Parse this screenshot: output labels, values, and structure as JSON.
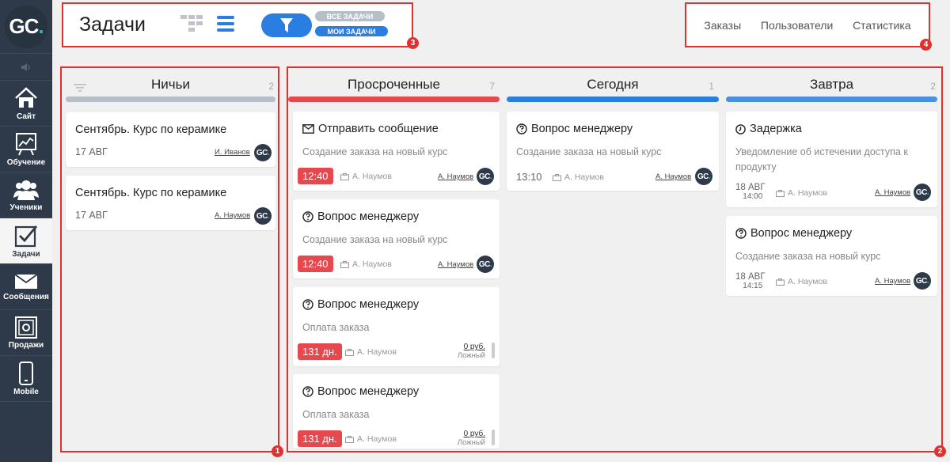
{
  "logo": {
    "text_main": "GC",
    "text_dot": "."
  },
  "sidebar": {
    "items": [
      {
        "label": "Сайт",
        "icon": "house-icon"
      },
      {
        "label": "Обучение",
        "icon": "chart-board-icon"
      },
      {
        "label": "Ученики",
        "icon": "users-icon"
      },
      {
        "label": "Задачи",
        "icon": "checkbox-icon",
        "active": true
      },
      {
        "label": "Сообщения",
        "icon": "envelope-icon"
      },
      {
        "label": "Продажи",
        "icon": "safe-icon"
      },
      {
        "label": "Mobile",
        "icon": "phone-icon"
      }
    ]
  },
  "header": {
    "title": "Задачи",
    "pill_all": "ВСЕ ЗАДАЧИ",
    "pill_mine": "МОИ ЗАДАЧИ",
    "links": [
      "Заказы",
      "Пользователи",
      "Статистика"
    ]
  },
  "annotations": [
    "1",
    "2",
    "3",
    "4"
  ],
  "colors": {
    "accent": "#2a7de1",
    "danger": "#e5484d",
    "gray_bar": "#b8bec8",
    "frame": "#e03131"
  },
  "columns": {
    "nobody": {
      "title": "Ничьи",
      "count": "2",
      "cards": [
        {
          "title": "Сентябрь. Курс по керамике",
          "date": "17 АВГ",
          "user": "И. Иванов"
        },
        {
          "title": "Сентябрь. Курс по керамике",
          "date": "17 АВГ",
          "user": "А. Наумов"
        }
      ]
    },
    "overdue": {
      "title": "Просроченные",
      "count": "7",
      "cards": [
        {
          "title": "Отправить сообщение",
          "sub": "Создание заказа на новый курс",
          "time": "12:40",
          "assignee": "А. Наумов",
          "user": "А. Наумов"
        },
        {
          "title": "Вопрос менеджеру",
          "sub": "Создание заказа на новый курс",
          "time": "12:40",
          "assignee": "А. Наумов",
          "user": "А. Наумов"
        },
        {
          "title": "Вопрос менеджеру",
          "sub": "Оплата заказа",
          "time": "131 дн.",
          "assignee": "А. Наумов",
          "amount": "0 руб.",
          "amount_label": "Ложный"
        },
        {
          "title": "Вопрос менеджеру",
          "sub": "Оплата заказа",
          "time": "131 дн.",
          "assignee": "А. Наумов",
          "amount": "0 руб.",
          "amount_label": "Ложный"
        }
      ]
    },
    "today": {
      "title": "Сегодня",
      "count": "1",
      "cards": [
        {
          "title": "Вопрос менеджеру",
          "sub": "Создание заказа на новый курс",
          "time": "13:10",
          "assignee": "А. Наумов",
          "user": "А. Наумов"
        }
      ]
    },
    "tomorrow": {
      "title": "Завтра",
      "count": "2",
      "cards": [
        {
          "title": "Задержка",
          "sub": "Уведомление об истечении доступа к продукту",
          "date": "18 АВГ",
          "time": "14:00",
          "assignee": "А. Наумов",
          "user": "А. Наумов"
        },
        {
          "title": "Вопрос менеджеру",
          "sub": "Создание заказа на новый курс",
          "date": "18 АВГ",
          "time": "14:15",
          "assignee": "А. Наумов",
          "user": "А. Наумов"
        }
      ]
    }
  }
}
